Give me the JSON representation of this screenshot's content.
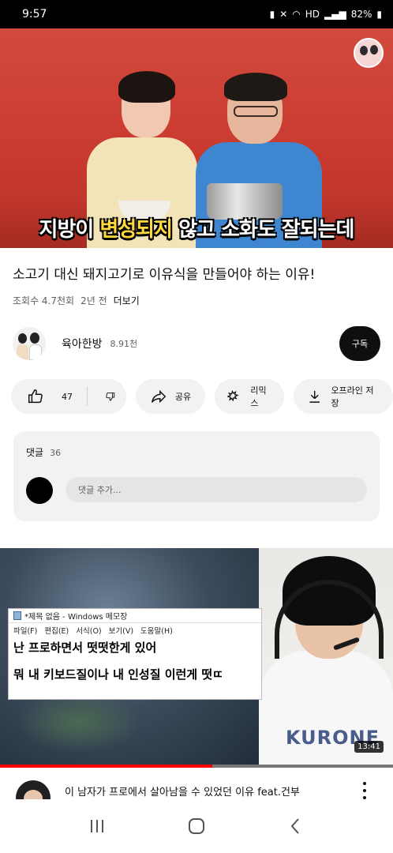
{
  "status_bar": {
    "time": "9:57",
    "battery_text": "82%",
    "network": "HD"
  },
  "player": {
    "subtitle_part1": "지방이 ",
    "subtitle_highlight": "변성되지",
    "subtitle_part2": " 않고 소화도 잘되는데"
  },
  "video": {
    "title": "소고기 대신 돼지고기로 이유식을 만들어야 하는 이유!",
    "views": "조회수 4.7천회",
    "age": "2년 전",
    "more": "더보기"
  },
  "channel": {
    "name": "육아한방",
    "subscribers": "8.91천",
    "subscribe_label": "구독"
  },
  "actions": {
    "like_count": "47",
    "share_label": "공유",
    "remix_label": "리믹스",
    "download_label": "오프라인 저장"
  },
  "comments": {
    "heading": "댓글",
    "count": "36",
    "placeholder": "댓글 추가..."
  },
  "next_video": {
    "notepad_title": "*제목 없음 - Windows 메모장",
    "notepad_menu": [
      "파일(F)",
      "편집(E)",
      "서식(O)",
      "보기(V)",
      "도움말(H)"
    ],
    "notepad_line1": "난 프로하면서 떳떳한게 있어",
    "notepad_line2": "뭐 내 키보드질이나 내 인성질 이런게 떳ㄸ",
    "shirt_text": "KURONE",
    "duration": "13:41",
    "progress": 0.54,
    "title": "이 남자가 프로에서 살아남을 수 있었던 이유 feat.건부"
  },
  "colors": {
    "player_bg": "#d24a3e",
    "subtitle_highlight": "#ffd83b",
    "progress": "#ff0000",
    "pill_bg": "#f2f2f2"
  }
}
